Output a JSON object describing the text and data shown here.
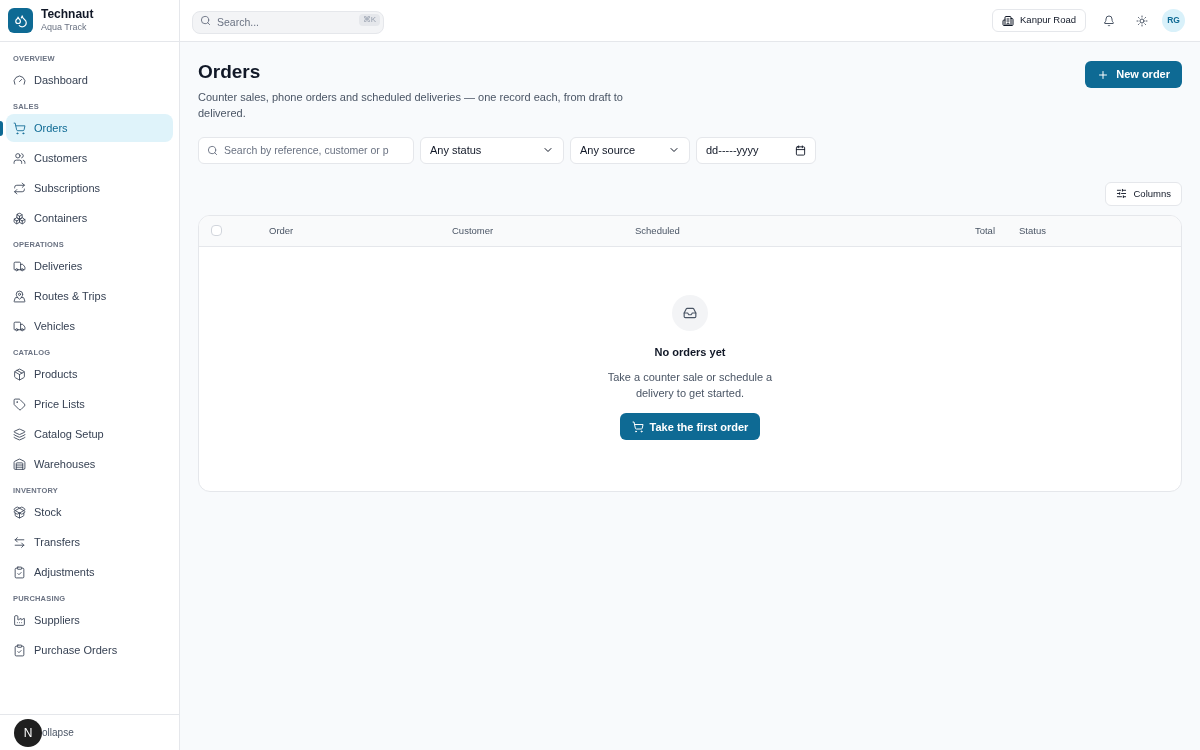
{
  "brand": {
    "name": "Technaut",
    "subtitle": "Aqua Track"
  },
  "sidebar": {
    "sections": [
      {
        "heading": "OVERVIEW",
        "items": [
          {
            "label": "Dashboard",
            "selected": false
          }
        ]
      },
      {
        "heading": "SALES",
        "items": [
          {
            "label": "Orders",
            "selected": true
          },
          {
            "label": "Customers",
            "selected": false
          },
          {
            "label": "Subscriptions",
            "selected": false
          },
          {
            "label": "Containers",
            "selected": false
          }
        ]
      },
      {
        "heading": "OPERATIONS",
        "items": [
          {
            "label": "Deliveries",
            "selected": false
          },
          {
            "label": "Routes & Trips",
            "selected": false
          },
          {
            "label": "Vehicles",
            "selected": false
          }
        ]
      },
      {
        "heading": "CATALOG",
        "items": [
          {
            "label": "Products",
            "selected": false
          },
          {
            "label": "Price Lists",
            "selected": false
          },
          {
            "label": "Catalog Setup",
            "selected": false
          },
          {
            "label": "Warehouses",
            "selected": false
          }
        ]
      },
      {
        "heading": "INVENTORY",
        "items": [
          {
            "label": "Stock",
            "selected": false
          },
          {
            "label": "Transfers",
            "selected": false
          },
          {
            "label": "Adjustments",
            "selected": false
          }
        ]
      },
      {
        "heading": "PURCHASING",
        "items": [
          {
            "label": "Suppliers",
            "selected": false
          },
          {
            "label": "Purchase Orders",
            "selected": false
          }
        ]
      }
    ],
    "footer": {
      "badge": "N",
      "label": "ollapse"
    }
  },
  "topbar": {
    "search": {
      "placeholder": "Search...",
      "shortcut": "⌘K"
    },
    "location": "Kanpur Road",
    "avatar": "RG"
  },
  "page": {
    "title": "Orders",
    "description": "Counter sales, phone orders and scheduled deliveries — one record each, from draft to delivered.",
    "new_button": "New order"
  },
  "filters": {
    "search": {
      "placeholder": "Search by reference, customer or p"
    },
    "status": "Any status",
    "source": "Any source",
    "date": "dd-----yyyy"
  },
  "columns_button": "Columns",
  "table": {
    "select_all": {
      "checked": false
    },
    "columns": [
      "Order",
      "Customer",
      "Scheduled",
      "Total",
      "Status"
    ]
  },
  "empty": {
    "title": "No orders yet",
    "text": "Take a counter sale or schedule a delivery to get started.",
    "button": "Take the first order"
  }
}
